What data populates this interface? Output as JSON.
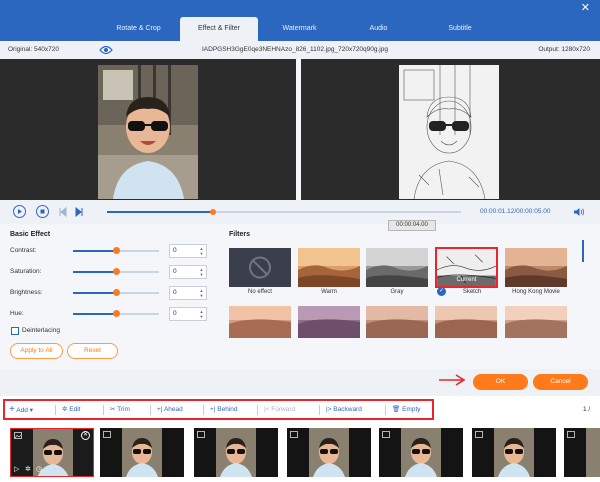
{
  "tabs": [
    {
      "label": "Rotate & Crop"
    },
    {
      "label": "Effect & Filter"
    },
    {
      "label": "Watermark"
    },
    {
      "label": "Audio"
    },
    {
      "label": "Subtitle"
    }
  ],
  "info": {
    "original": "Original: 540x720",
    "filename": "IADPGSH3GgE0qe3NEHNAzo_826_1102.jpg_720x720q90g.jpg",
    "output": "Output: 1280x720"
  },
  "playback": {
    "time": "00:00:01.12/00:00:05.00",
    "tooltip": "00:00:04.00",
    "progress": 0.3
  },
  "basic_effect": {
    "title": "Basic Effect",
    "controls": [
      {
        "label": "Contrast:",
        "value": "0",
        "level": 0.5
      },
      {
        "label": "Saturation:",
        "value": "0",
        "level": 0.5
      },
      {
        "label": "Brightness:",
        "value": "0",
        "level": 0.5
      },
      {
        "label": "Hue:",
        "value": "0",
        "level": 0.5
      }
    ],
    "deinterlacing": "Deinterlacing",
    "apply_all": "Apply to All",
    "reset": "Reset"
  },
  "filters": {
    "title": "Filters",
    "row1": [
      {
        "label": "No effect"
      },
      {
        "label": "Warm"
      },
      {
        "label": "Gray"
      },
      {
        "label": "Sketch",
        "overlay": "Current"
      },
      {
        "label": "Hong Kong Movie"
      }
    ]
  },
  "actions": {
    "ok": "OK",
    "cancel": "Cancel"
  },
  "toolbar": {
    "add": "Add",
    "edit": "Edit",
    "trim": "Trim",
    "ahead": "Ahead",
    "behind": "Behind",
    "forward": "Forward",
    "backward": "Backward",
    "empty": "Empty",
    "page": "1 /"
  },
  "colors": {
    "primary": "#2c67bf",
    "accent": "#ff7a1a",
    "highlight": "#e8262c"
  }
}
